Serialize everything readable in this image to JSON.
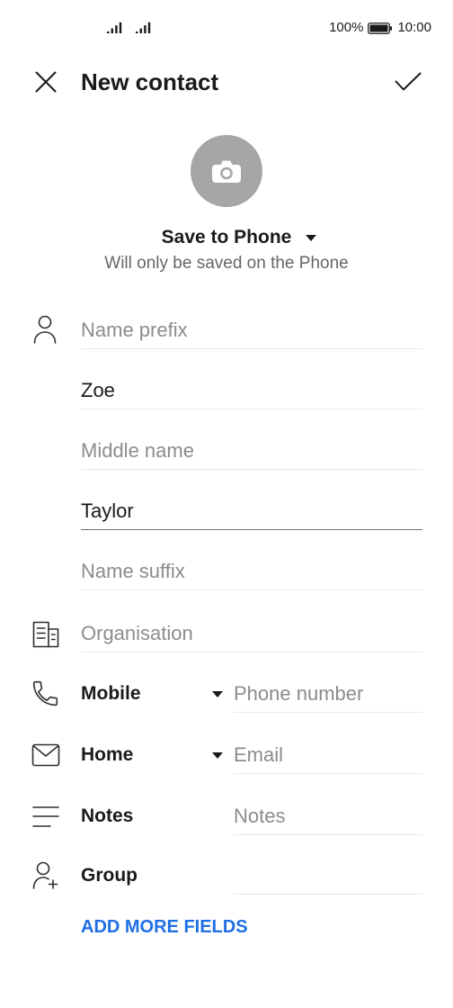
{
  "status_bar": {
    "signal_strength": [
      1.0,
      1.0
    ],
    "battery_percent": "100%",
    "battery_level": 1.0,
    "time": "10:00"
  },
  "header": {
    "title": "New contact"
  },
  "account": {
    "label": "Save to Phone",
    "note": "Will only be saved on the Phone"
  },
  "form": {
    "name_prefix": {
      "placeholder": "Name prefix"
    },
    "first_name": {
      "value": "Zoe"
    },
    "middle_name": {
      "placeholder": "Middle name"
    },
    "last_name": {
      "value": "Taylor"
    },
    "name_suffix": {
      "placeholder": "Name suffix"
    },
    "organisation": {
      "placeholder": "Organisation"
    },
    "phone": {
      "type": "Mobile",
      "placeholder": "Phone number"
    },
    "email": {
      "type": "Home",
      "placeholder": "Email"
    },
    "notes": {
      "label": "Notes",
      "placeholder": "Notes"
    },
    "group": {
      "label": "Group"
    }
  },
  "add_more_fields": "ADD MORE FIELDS",
  "icons": {
    "close": "close-icon",
    "confirm": "check-icon",
    "photo": "camera-icon",
    "dropdown": "caret-down-icon",
    "name": "person-icon",
    "organisation": "organisation-icon",
    "phone": "phone-icon",
    "email": "mail-icon",
    "notes": "notes-icon",
    "group": "group-add-icon"
  },
  "colors": {
    "text": "#1a1a1a",
    "placeholder": "#8c8c8c",
    "secondary": "#666666",
    "divider": "#e8e8e8",
    "active_divider": "#707070",
    "avatar_bg": "#a6a6a6",
    "accent": "#1f6fe5",
    "icon": "#2e2e2e"
  }
}
